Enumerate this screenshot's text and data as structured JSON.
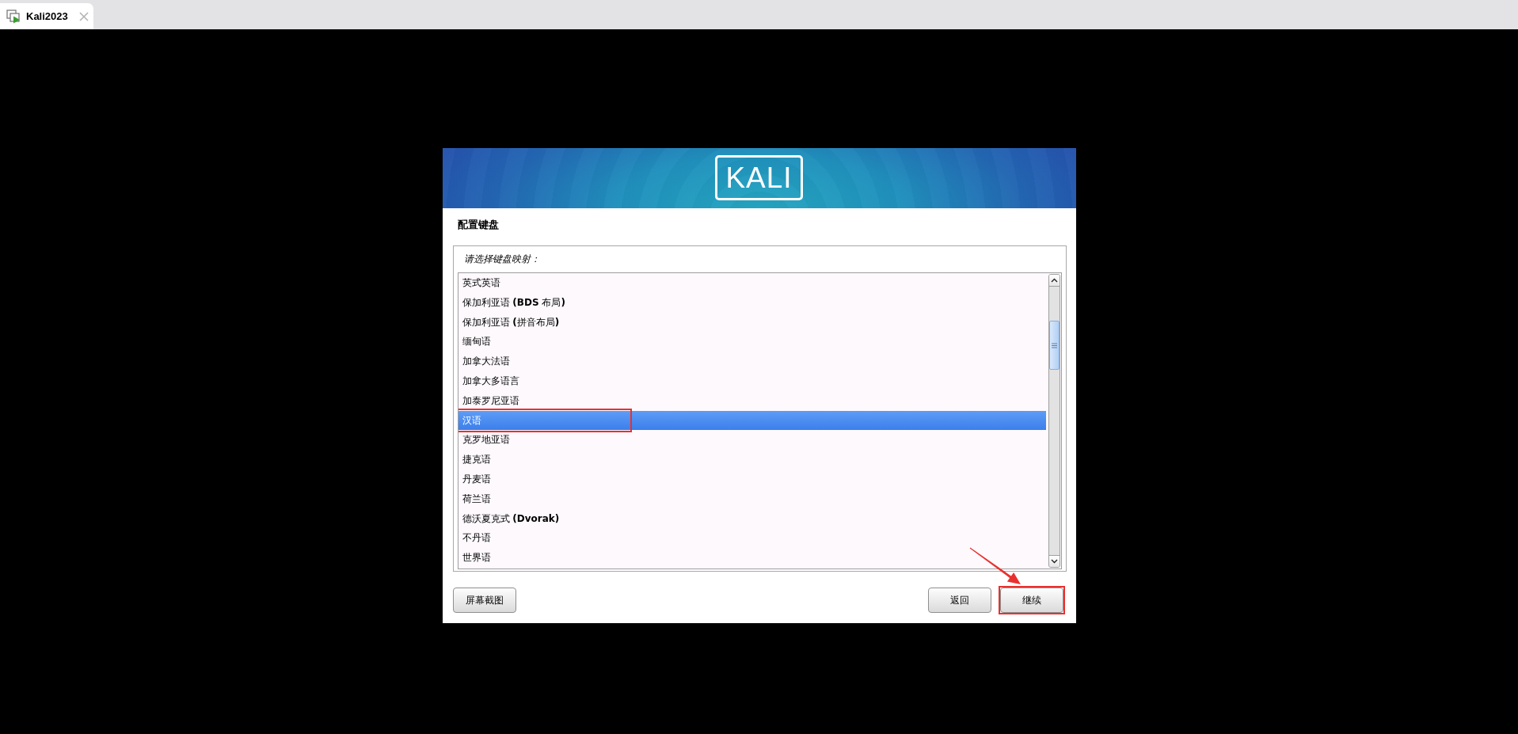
{
  "tab": {
    "title": "Kali2023",
    "selected": true
  },
  "installer": {
    "logo": "KALI",
    "title": "配置键盘",
    "prompt": "请选择键盘映射：",
    "options": [
      {
        "label": "英式英语",
        "selected": false,
        "marked": false
      },
      {
        "label": "保加利亚语 **(BDS** 布局**)**",
        "selected": false,
        "marked": false
      },
      {
        "label": "保加利亚语 **(**拼音布局**)**",
        "selected": false,
        "marked": false
      },
      {
        "label": "缅甸语",
        "selected": false,
        "marked": false
      },
      {
        "label": "加拿大法语",
        "selected": false,
        "marked": false
      },
      {
        "label": "加拿大多语言",
        "selected": false,
        "marked": false
      },
      {
        "label": "加泰罗尼亚语",
        "selected": false,
        "marked": false
      },
      {
        "label": "汉语",
        "selected": true,
        "marked": true
      },
      {
        "label": "克罗地亚语",
        "selected": false,
        "marked": false
      },
      {
        "label": "捷克语",
        "selected": false,
        "marked": false
      },
      {
        "label": "丹麦语",
        "selected": false,
        "marked": false
      },
      {
        "label": "荷兰语",
        "selected": false,
        "marked": false
      },
      {
        "label": "德沃夏克式 **(Dvorak)**",
        "selected": false,
        "marked": false
      },
      {
        "label": "不丹语",
        "selected": false,
        "marked": false
      },
      {
        "label": "世界语",
        "selected": false,
        "marked": false
      }
    ],
    "left_buttons": [
      {
        "label": "屏幕截图",
        "marked": false
      }
    ],
    "right_buttons": [
      {
        "label": "返回",
        "marked": false
      },
      {
        "label": "继续",
        "marked": true
      }
    ]
  }
}
